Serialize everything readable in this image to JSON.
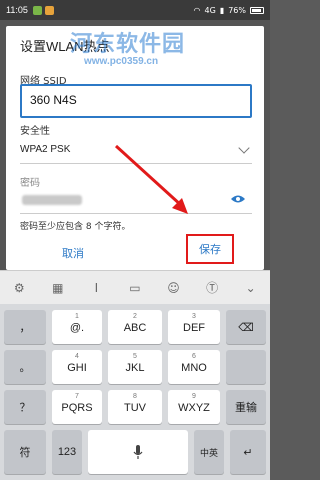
{
  "status_bar": {
    "time": "11:05",
    "network": "4G",
    "battery": "76%"
  },
  "watermark": {
    "text": "河东软件园",
    "url": "www.pc0359.cn"
  },
  "dialog": {
    "title": "设置WLAN热点",
    "ssid_label": "网络 SSID",
    "ssid_value": "360 N4S",
    "security_label": "安全性",
    "security_value": "WPA2 PSK",
    "password_label": "密码",
    "hint": "密码至少应包含 8 个字符。",
    "cancel_label": "取消",
    "save_label": "保存"
  },
  "keyboard": {
    "row1": [
      {
        "sub": "",
        "main": "，"
      },
      {
        "sub": "1",
        "main": "@."
      },
      {
        "sub": "2",
        "main": "ABC"
      },
      {
        "sub": "3",
        "main": "DEF"
      }
    ],
    "row2": [
      {
        "sub": "",
        "main": "。"
      },
      {
        "sub": "4",
        "main": "GHI"
      },
      {
        "sub": "5",
        "main": "JKL"
      },
      {
        "sub": "6",
        "main": "MNO"
      }
    ],
    "row3": [
      {
        "sub": "",
        "main": "？"
      },
      {
        "sub": "7",
        "main": "PQRS"
      },
      {
        "sub": "8",
        "main": "TUV"
      },
      {
        "sub": "9",
        "main": "WXYZ"
      }
    ],
    "row4": [
      {
        "sub": "",
        "main": "！"
      }
    ],
    "backspace": "⌫",
    "reenter": "重输",
    "enter": "↵",
    "symbol": "符",
    "num": "123",
    "zh_en": "中英",
    "space_icon": "mic-icon"
  },
  "colors": {
    "accent": "#2c79c6",
    "highlight": "#e11a1a"
  }
}
